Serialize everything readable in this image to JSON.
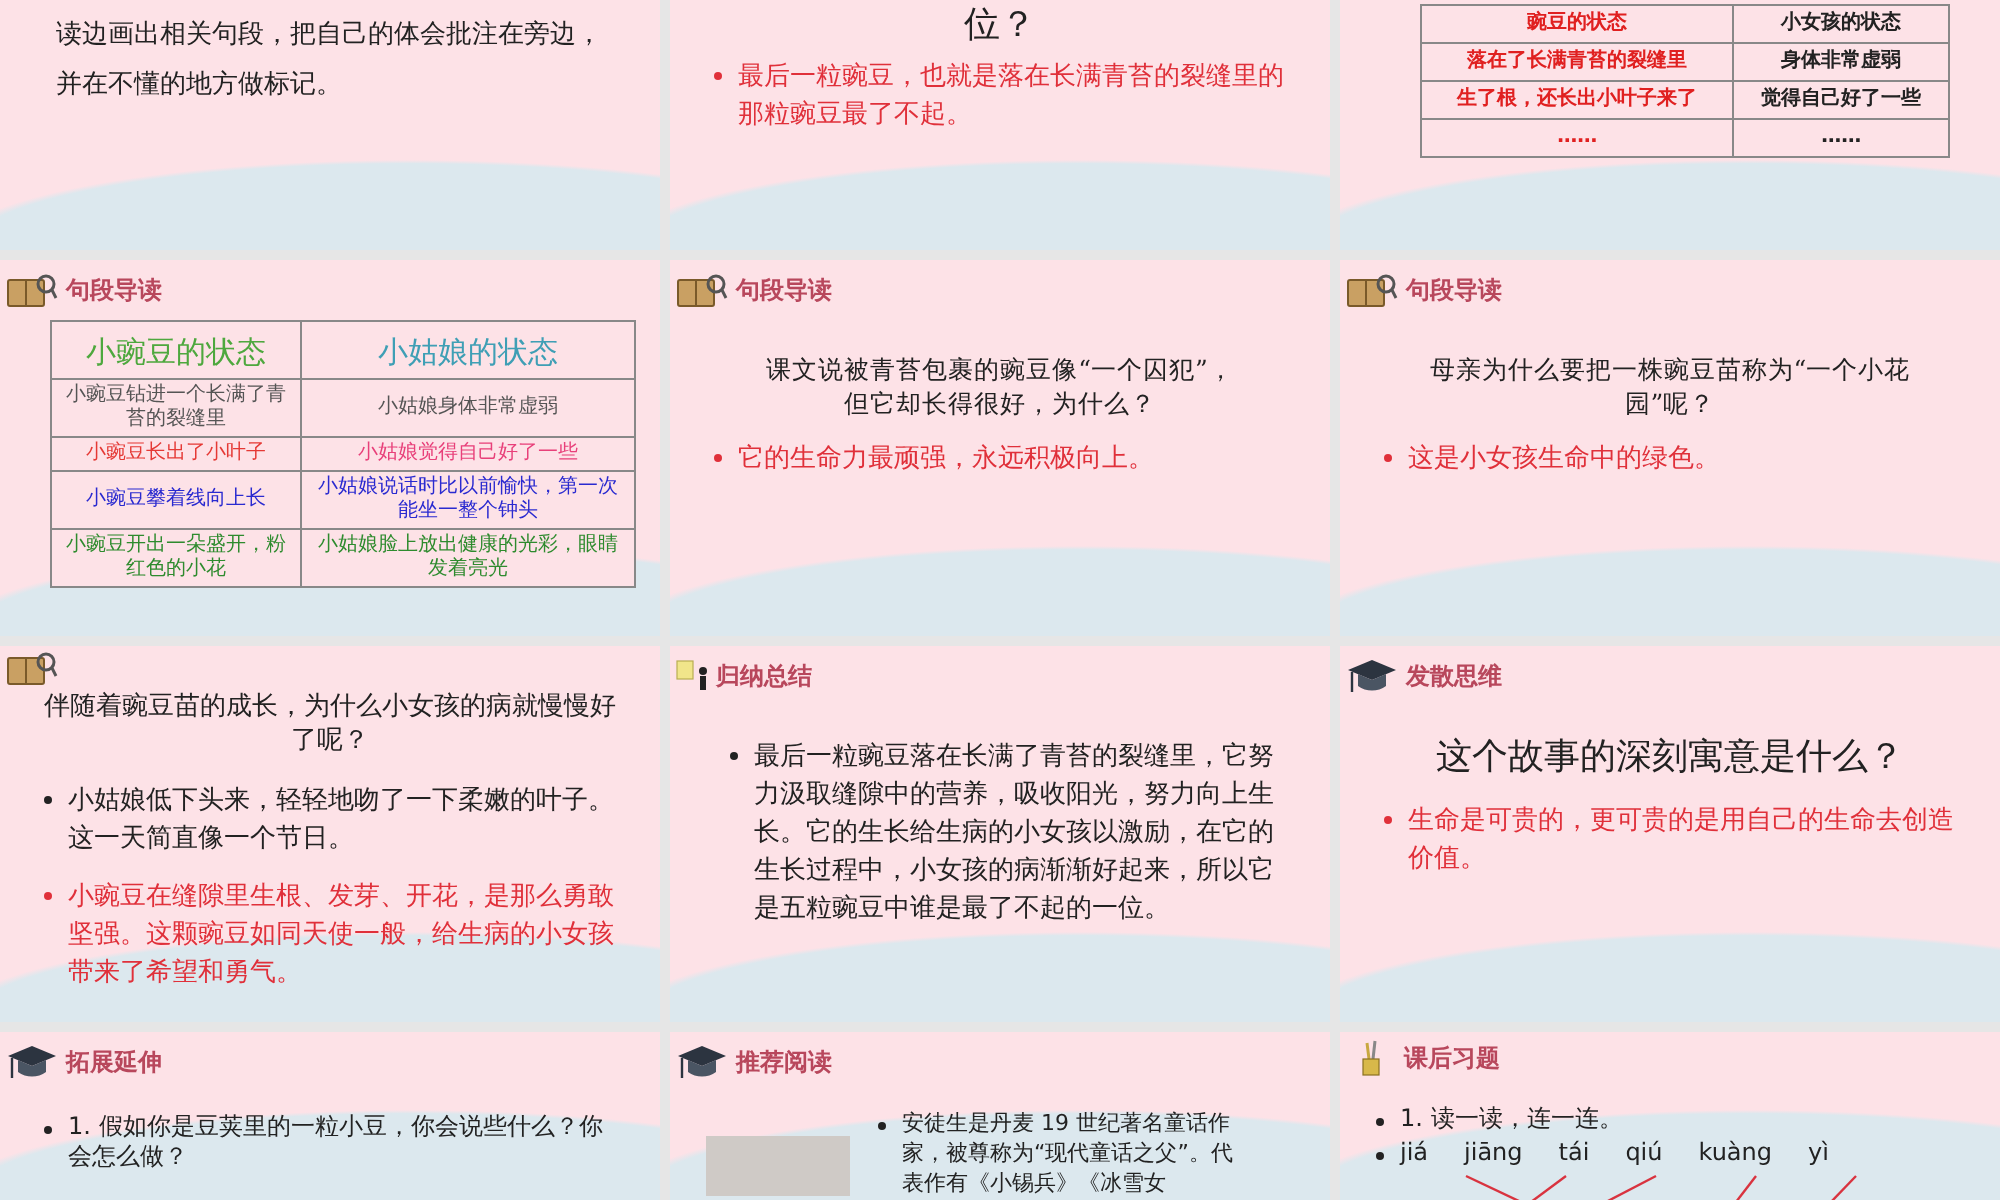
{
  "slides": [
    {
      "kind": "paragraph",
      "paragraph": "读边画出相关句段，把自己的体会批注在旁边，并在不懂的地方做标记。"
    },
    {
      "kind": "text",
      "question": "位？",
      "bullets": [
        {
          "text": "最后一粒豌豆，也就是落在长满青苔的裂缝里的那粒豌豆最了不起。",
          "color": "#e0303a"
        }
      ]
    },
    {
      "kind": "table",
      "table": {
        "header": [
          {
            "text": "豌豆的状态",
            "color": "#e02020"
          },
          {
            "text": "小女孩的状态",
            "color": "#222222"
          }
        ],
        "rows": [
          [
            {
              "text": "落在了长满青苔的裂缝里",
              "color": "#e02020"
            },
            {
              "text": "身体非常虚弱",
              "color": "#222222"
            }
          ],
          [
            {
              "text": "生了根，还长出小叶子来了",
              "color": "#e02020"
            },
            {
              "text": "觉得自己好了一些",
              "color": "#222222"
            }
          ],
          [
            {
              "text": "……",
              "color": "#e02020"
            },
            {
              "text": "……",
              "color": "#222222"
            }
          ]
        ]
      }
    },
    {
      "kind": "table",
      "header": {
        "kind": "book",
        "title": "句段导读"
      },
      "table": {
        "header": [
          {
            "text": "小豌豆的状态",
            "color": "#4ea83e"
          },
          {
            "text": "小姑娘的状态",
            "color": "#3f9fb5"
          }
        ],
        "rows": [
          [
            {
              "text": "小豌豆钻进一个长满了青苔的裂缝里",
              "color": "#555555"
            },
            {
              "text": "小姑娘身体非常虚弱",
              "color": "#555555"
            }
          ],
          [
            {
              "text": "小豌豆长出了小叶子",
              "color": "#e53935"
            },
            {
              "text": "小姑娘觉得自己好了一些",
              "color": "#e8407a"
            }
          ],
          [
            {
              "text": "小豌豆攀着线向上长",
              "color": "#2a2ad0"
            },
            {
              "text": "小姑娘说话时比以前愉快，第一次能坐一整个钟头",
              "color": "#2a2ad0"
            }
          ],
          [
            {
              "text": "小豌豆开出一朵盛开，粉红色的小花",
              "color": "#2e8b2e"
            },
            {
              "text": "小姑娘脸上放出健康的光彩，眼睛发着亮光",
              "color": "#2e8b2e"
            }
          ]
        ]
      }
    },
    {
      "kind": "text",
      "header": {
        "kind": "book",
        "title": "句段导读"
      },
      "question": "课文说被青苔包裹的豌豆像“一个囚犯”，但它却长得很好，为什么？",
      "bullets": [
        {
          "text": "它的生命力最顽强，永远积极向上。",
          "color": "#e0303a"
        }
      ]
    },
    {
      "kind": "text",
      "header": {
        "kind": "book",
        "title": "句段导读"
      },
      "question": "母亲为什么要把一株豌豆苗称为“一个小花园”呢？",
      "bullets": [
        {
          "text": "这是小女孩生命中的绿色。",
          "color": "#e0303a"
        }
      ]
    },
    {
      "kind": "text",
      "header": {
        "kind": "book"
      },
      "question": "伴随着豌豆苗的成长，为什么小女孩的病就慢慢好了呢？",
      "bullets": [
        {
          "text": "小姑娘低下头来，轻轻地吻了一下柔嫩的叶子。这一天简直像一个节日。",
          "color": "#222222"
        },
        {
          "text": "小豌豆在缝隙里生根、发芽、开花，是那么勇敢坚强。这颗豌豆如同天使一般，给生病的小女孩带来了希望和勇气。",
          "color": "#e0303a"
        }
      ]
    },
    {
      "kind": "text",
      "header": {
        "kind": "summary",
        "title": "归纳总结"
      },
      "bullets": [
        {
          "text": "最后一粒豌豆落在长满了青苔的裂缝里，它努力汲取缝隙中的营养，吸收阳光，努力向上生长。它的生长给生病的小女孩以激励，在它的生长过程中，小女孩的病渐渐好起来，所以它是五粒豌豆中谁是最了不起的一位。",
          "color": "#222222"
        }
      ]
    },
    {
      "kind": "text",
      "header": {
        "kind": "cap",
        "title": "发散思维"
      },
      "question": "这个故事的深刻寓意是什么？",
      "bullets": [
        {
          "text": "生命是可贵的，更可贵的是用自己的生命去创造价值。",
          "color": "#e0303a"
        }
      ]
    },
    {
      "kind": "text",
      "header": {
        "kind": "cap",
        "title": "拓展延伸"
      },
      "bullets": [
        {
          "text": "1. 假如你是豆荚里的一粒小豆，你会说些什么？你会怎么做？",
          "color": "#222222"
        }
      ]
    },
    {
      "kind": "photo-text",
      "header": {
        "kind": "cap",
        "title": "推荐阅读"
      },
      "bullets": [
        {
          "text": "安徒生是丹麦 19 世纪著名童话作家，被尊称为“现代童话之父”。代表作有《小锡兵》《冰雪女",
          "color": "#222222"
        }
      ]
    },
    {
      "kind": "exercise",
      "header": {
        "kind": "exercise",
        "title": "课后习题"
      },
      "bullets": [
        {
          "text": "1. 读一读，连一连。",
          "color": "#222222"
        }
      ],
      "pinyin": [
        "jiá",
        "jiāng",
        "tái",
        "qiú",
        "kuàng",
        "yì"
      ]
    }
  ]
}
